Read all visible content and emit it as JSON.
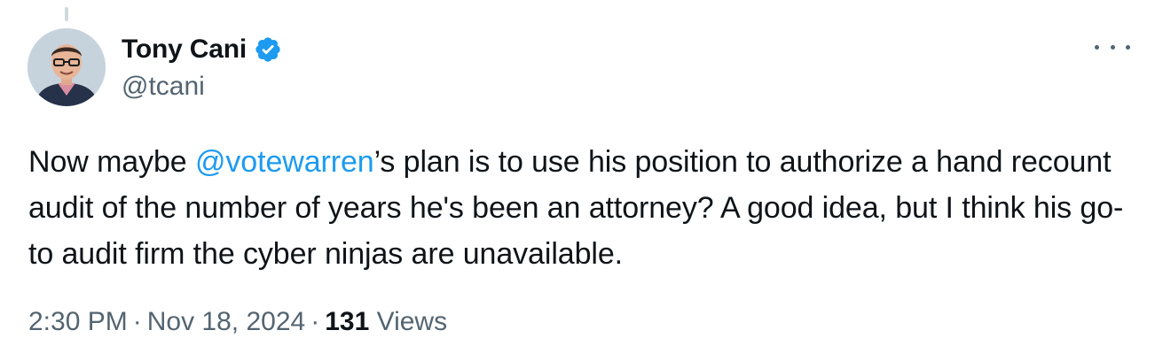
{
  "tweet": {
    "author": {
      "display_name": "Tony Cani",
      "handle": "@tcani",
      "verified": true,
      "verified_icon": "verified-badge-icon",
      "avatar_icon": "avatar-photo"
    },
    "more_icon": "more-options-icon",
    "text": {
      "before": "Now maybe ",
      "mention": "@votewarren",
      "after": "’s plan is to use his position to authorize a hand recount audit of the number of years he's been an attorney? A good idea, but I think his go-to audit firm the cyber ninjas are unavailable."
    },
    "meta": {
      "time": "2:30 PM",
      "separator": "·",
      "date": "Nov 18, 2024",
      "views_count": "131",
      "views_label": "Views"
    }
  },
  "colors": {
    "text": "#0f1419",
    "secondary": "#536471",
    "link": "#1d9bf0",
    "verified": "#1d9bf0"
  }
}
